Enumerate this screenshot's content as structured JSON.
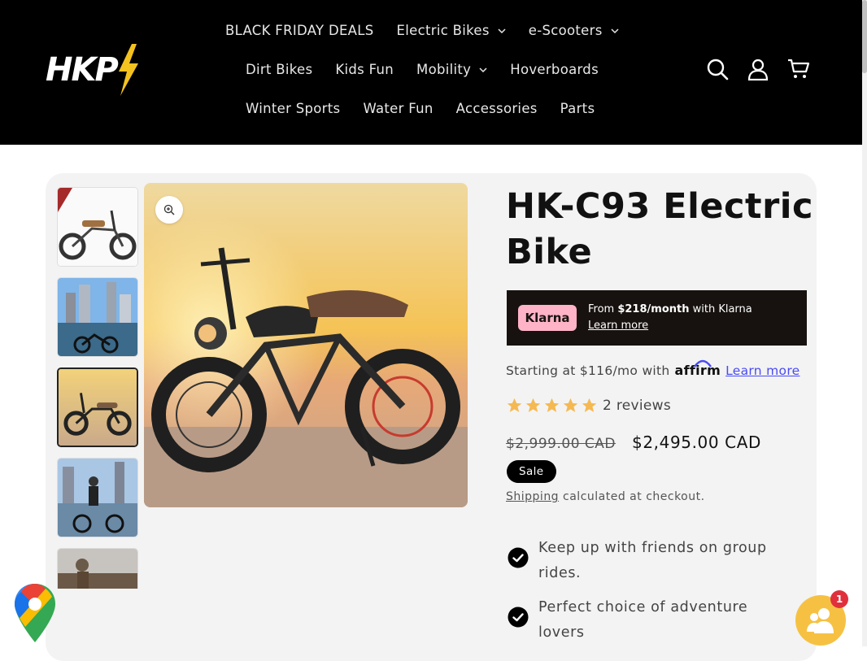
{
  "header": {
    "logo_text": "HKP",
    "nav_rows": [
      [
        {
          "label": "BLACK FRIDAY DEALS",
          "dropdown": false
        },
        {
          "label": "Electric Bikes",
          "dropdown": true
        },
        {
          "label": "e-Scooters",
          "dropdown": true
        }
      ],
      [
        {
          "label": "Dirt Bikes",
          "dropdown": false
        },
        {
          "label": "Kids Fun",
          "dropdown": false
        },
        {
          "label": "Mobility",
          "dropdown": true
        },
        {
          "label": "Hoverboards",
          "dropdown": false
        }
      ],
      [
        {
          "label": "Winter Sports",
          "dropdown": false
        },
        {
          "label": "Water Fun",
          "dropdown": false
        },
        {
          "label": "Accessories",
          "dropdown": false
        },
        {
          "label": "Parts",
          "dropdown": false
        }
      ]
    ],
    "icons": [
      "search-icon",
      "account-icon",
      "cart-icon"
    ]
  },
  "product": {
    "title": "HK-C93 Electric Bike",
    "klarna": {
      "badge": "Klarna",
      "prefix": "From ",
      "amount": "$218/month",
      "suffix": " with Klarna",
      "learn_more": "Learn more"
    },
    "affirm": {
      "prefix": "Starting at $116/mo with",
      "logo": "affirm",
      "learn_more": "Learn more"
    },
    "rating": {
      "stars": 5,
      "reviews_label": "2 reviews"
    },
    "regular_price": "$2,999.00 CAD",
    "sale_price": "$2,495.00 CAD",
    "sale_badge": "Sale",
    "shipping": {
      "link": "Shipping",
      "text": " calculated at checkout."
    },
    "features": [
      "Keep up with friends on group rides.",
      "Perfect choice of adventure lovers"
    ],
    "thumbnails_count": 5,
    "active_thumbnail": 3
  },
  "widgets": {
    "chat_badge_count": "1"
  },
  "colors": {
    "header_bg": "#000000",
    "logo_bolt": "#f4c21f",
    "klarna_bg": "#17120f",
    "klarna_pink": "#ffb3c7",
    "star": "#f5b953",
    "affirm_link": "#4a4af4",
    "chat_bg": "#f6c143"
  }
}
